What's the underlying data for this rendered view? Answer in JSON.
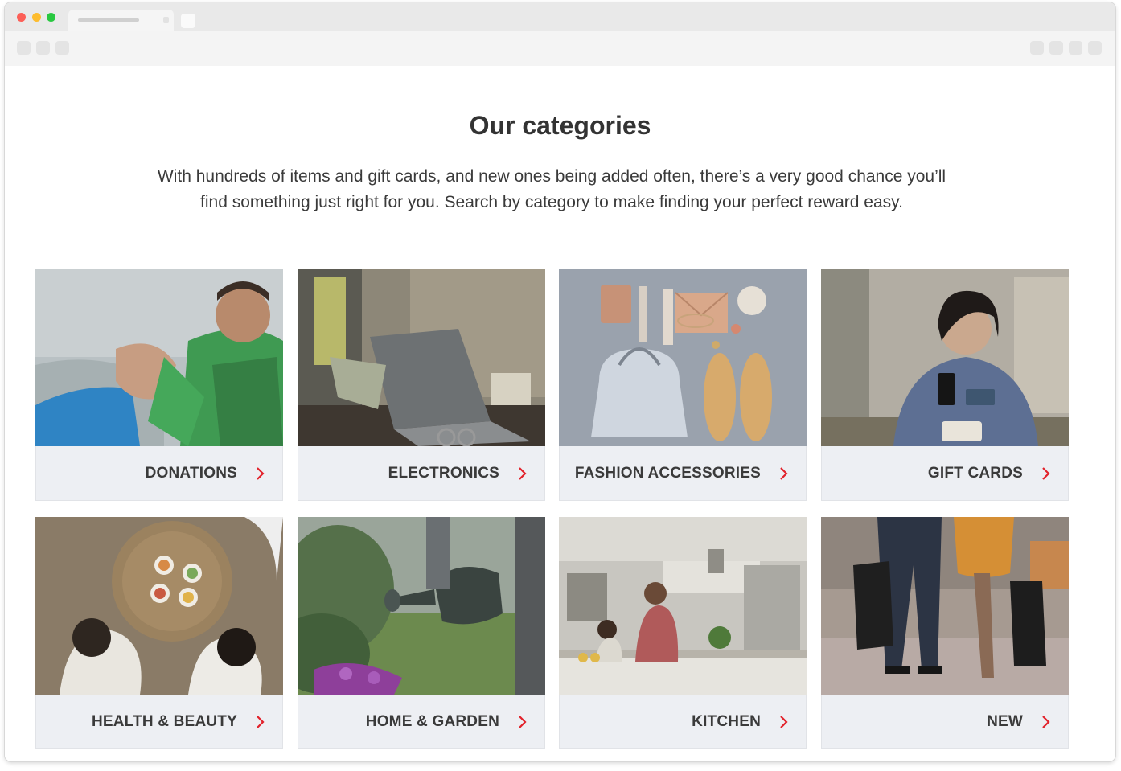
{
  "page": {
    "title": "Our categories",
    "intro_line1": "With hundreds of items and gift cards, and new ones being added often, there’s a very good chance you’ll",
    "intro_line2": "find something just right for you. Search by category to make finding your perfect reward easy."
  },
  "categories": [
    {
      "label": "DONATIONS",
      "image": "helping-hand-photo"
    },
    {
      "label": "ELECTRONICS",
      "image": "laptop-desk-photo"
    },
    {
      "label": "FASHION ACCESSORIES",
      "image": "flatlay-accessories-photo"
    },
    {
      "label": "GIFT CARDS",
      "image": "woman-phone-card-photo"
    },
    {
      "label": "HEALTH & BEAUTY",
      "image": "friends-table-photo"
    },
    {
      "label": "HOME & GARDEN",
      "image": "watering-can-photo"
    },
    {
      "label": "KITCHEN",
      "image": "family-kitchen-photo"
    },
    {
      "label": "NEW",
      "image": "shopping-bags-photo"
    }
  ],
  "colors": {
    "accent": "#e2222b",
    "caption_bg": "#edeff3",
    "title_text": "#333333"
  },
  "icons": {
    "chevron": "chevron-right-icon"
  }
}
